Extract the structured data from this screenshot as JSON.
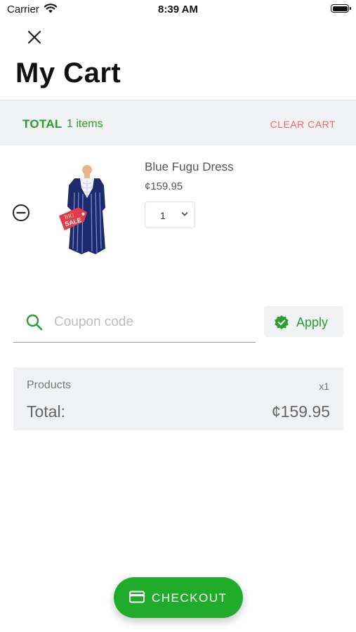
{
  "status_bar": {
    "carrier": "Carrier",
    "time": "8:39 AM"
  },
  "header": {
    "title": "My Cart"
  },
  "summary": {
    "total_label": "TOTAL",
    "item_count": "1 items",
    "clear_label": "CLEAR CART"
  },
  "cart": {
    "items": [
      {
        "name": "Blue Fugu Dress",
        "price": "¢159.95",
        "quantity": "1",
        "image_badge": [
          "BIG",
          "SALE"
        ]
      }
    ]
  },
  "coupon": {
    "placeholder": "Coupon code",
    "value": "",
    "apply_label": "Apply"
  },
  "totals": {
    "products_label": "Products",
    "products_qty": "x1",
    "total_label": "Total:",
    "total_amount": "¢159.95"
  },
  "checkout": {
    "label": "CHECKOUT"
  },
  "colors": {
    "accent": "#21ab2a",
    "danger": "#ee6b6b",
    "panel": "#f0f2f4"
  }
}
